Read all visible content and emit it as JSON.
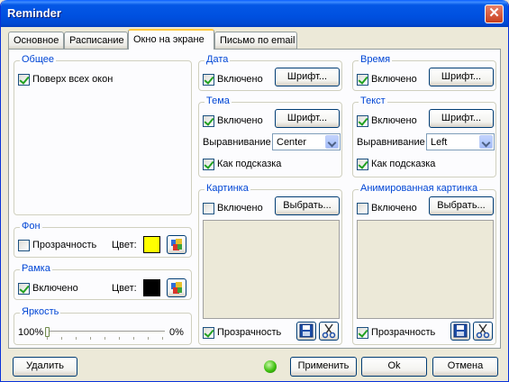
{
  "window": {
    "title": "Reminder",
    "close_glyph": "✕"
  },
  "tabs": [
    {
      "label": "Основное",
      "active": false
    },
    {
      "label": "Расписание",
      "active": false
    },
    {
      "label": "Окно на экране",
      "active": true
    },
    {
      "label": "Письмо по email",
      "active": false
    }
  ],
  "general": {
    "title": "Общее",
    "on_top": {
      "label": "Поверх всех окон",
      "checked": true
    }
  },
  "background": {
    "title": "Фон",
    "transparency": {
      "label": "Прозрачность",
      "checked": false
    },
    "color_label": "Цвет:",
    "color": "#FFFF00"
  },
  "frame": {
    "title": "Рамка",
    "enabled": {
      "label": "Включено",
      "checked": true
    },
    "color_label": "Цвет:",
    "color": "#000000"
  },
  "brightness": {
    "title": "Яркость",
    "left_label": "100%",
    "right_label": "0%",
    "value_fraction": 0.0
  },
  "date": {
    "title": "Дата",
    "enabled": {
      "label": "Включено",
      "checked": true
    },
    "font_button": "Шрифт..."
  },
  "time": {
    "title": "Время",
    "enabled": {
      "label": "Включено",
      "checked": true
    },
    "font_button": "Шрифт..."
  },
  "theme": {
    "title": "Тема",
    "enabled": {
      "label": "Включено",
      "checked": true
    },
    "font_button": "Шрифт...",
    "align_label": "Выравнивание",
    "align_value": "Center",
    "tooltip": {
      "label": "Как подсказка",
      "checked": true
    }
  },
  "text": {
    "title": "Текст",
    "enabled": {
      "label": "Включено",
      "checked": true
    },
    "font_button": "Шрифт...",
    "align_label": "Выравнивание",
    "align_value": "Left",
    "tooltip": {
      "label": "Как подсказка",
      "checked": true
    }
  },
  "picture": {
    "title": "Картинка",
    "enabled": {
      "label": "Включено",
      "checked": false
    },
    "choose_button": "Выбрать...",
    "transparency": {
      "label": "Прозрачность",
      "checked": true
    }
  },
  "animated": {
    "title": "Анимированная картинка",
    "enabled": {
      "label": "Включено",
      "checked": false
    },
    "choose_button": "Выбрать...",
    "transparency": {
      "label": "Прозрачность",
      "checked": true
    }
  },
  "footer": {
    "delete_button": "Удалить",
    "apply_button": "Применить",
    "ok_button": "Ok",
    "cancel_button": "Отмена",
    "status_color": "#40C010"
  }
}
